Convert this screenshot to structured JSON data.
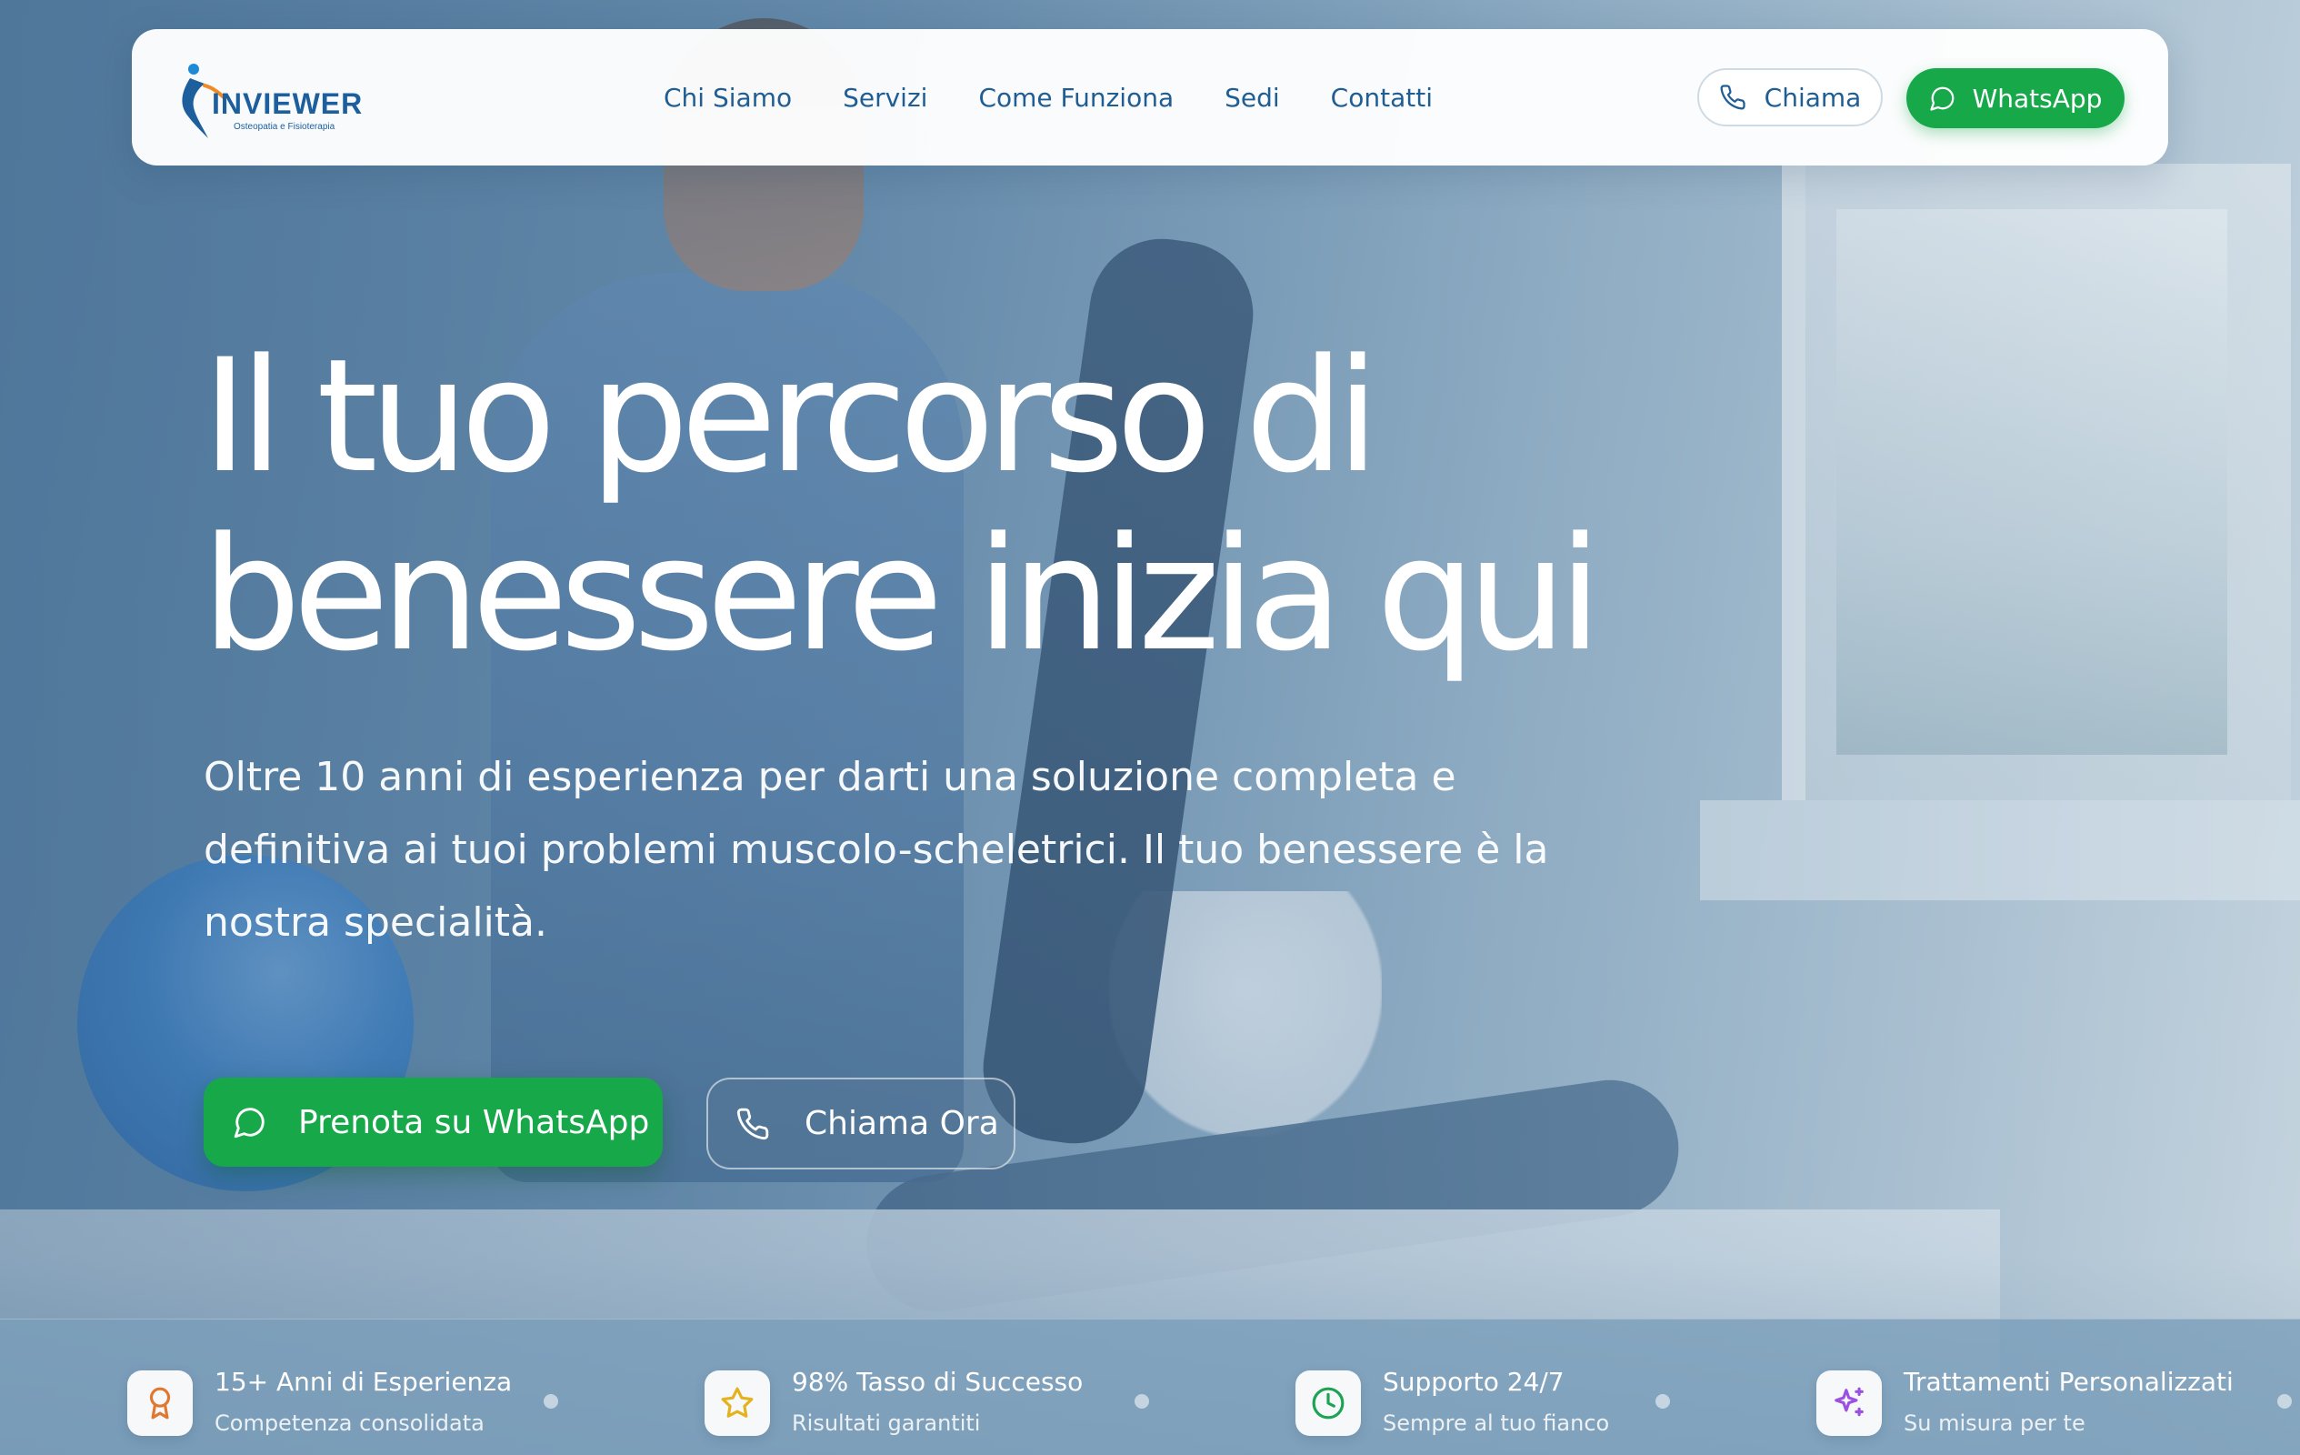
{
  "brand": {
    "name": "INVIEWER",
    "tagline": "Osteopatia e Fisioterapia",
    "color": "#1d5f9c",
    "accent": "#17a84a"
  },
  "nav": {
    "items": [
      "Chi Siamo",
      "Servizi",
      "Come Funziona",
      "Sedi",
      "Contatti"
    ]
  },
  "header_actions": {
    "call_label": "Chiama",
    "call_icon": "phone-icon",
    "whatsapp_label": "WhatsApp",
    "whatsapp_icon": "whatsapp-icon"
  },
  "hero": {
    "title_line1": "Il tuo percorso di",
    "title_line2": "benessere inizia qui",
    "subtitle": "Oltre 10 anni di esperienza per darti una soluzione completa e definitiva ai tuoi problemi muscolo-scheletrici. Il tuo benessere è la nostra specialità.",
    "primary_cta": "Prenota su WhatsApp",
    "secondary_cta": "Chiama Ora"
  },
  "stats": [
    {
      "title": "15+ Anni di Esperienza",
      "subtitle": "Competenza consolidata",
      "icon": "award-icon",
      "color": "#e0782f"
    },
    {
      "title": "98% Tasso di Successo",
      "subtitle": "Risultati garantiti",
      "icon": "star-icon",
      "color": "#e3b21d"
    },
    {
      "title": "Supporto 24/7",
      "subtitle": "Sempre al tuo fianco",
      "icon": "clock-icon",
      "color": "#1ca354"
    },
    {
      "title": "Trattamenti Personalizzati",
      "subtitle": "Su misura per te",
      "icon": "sparkles-icon",
      "color": "#9b52e0"
    }
  ]
}
